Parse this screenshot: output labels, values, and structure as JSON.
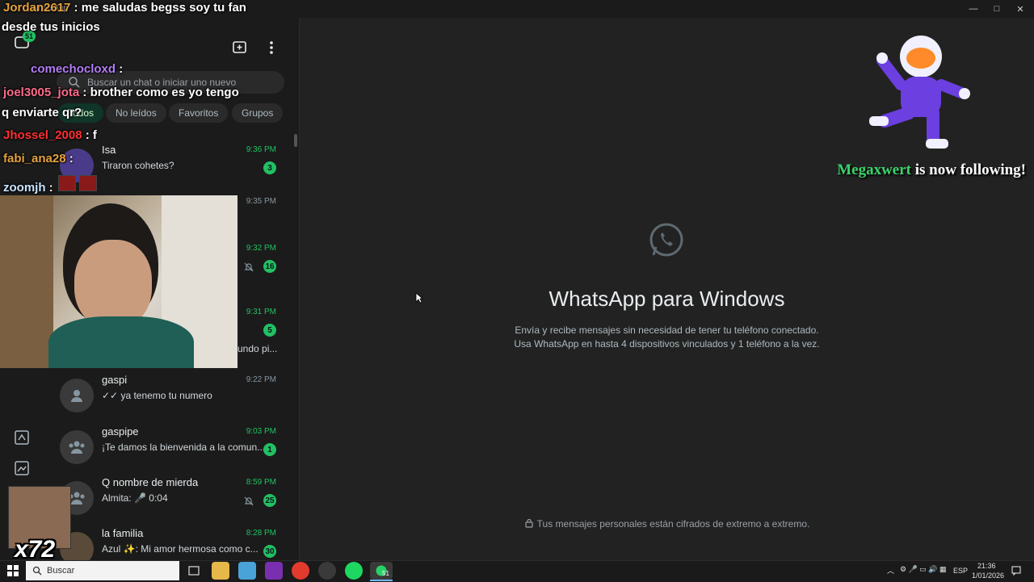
{
  "window": {
    "title": "WhatsApp",
    "min": "—",
    "max": "□",
    "close": "✕"
  },
  "nav": {
    "chats_badge": "51"
  },
  "search": {
    "placeholder": "Buscar un chat o iniciar uno nuevo"
  },
  "filters": [
    "Todos",
    "No leídos",
    "Favoritos",
    "Grupos"
  ],
  "chats": [
    {
      "name": "Isa",
      "preview": "Tiraron cohetes?",
      "time": "9:36 PM",
      "badge": "3",
      "muted": false
    },
    {
      "name": "",
      "preview": "",
      "time": "9:35 PM",
      "badge": "",
      "muted": false
    },
    {
      "name": "",
      "preview": "",
      "time": "9:32 PM",
      "badge": "16",
      "muted": true
    },
    {
      "name": "",
      "preview": "undo pi...",
      "time": "9:31 PM",
      "badge": "5",
      "muted": false
    },
    {
      "name": "gaspi",
      "preview": "✓✓ ya tenemo tu numero",
      "time": "9:22 PM",
      "badge": "",
      "muted": false
    },
    {
      "name": "gaspipe",
      "preview": "¡Te damos la bienvenida a la comun...",
      "time": "9:03 PM",
      "badge": "1",
      "muted": false
    },
    {
      "name": "Q nombre de mierda",
      "preview": "Almita: 🎤 0:04",
      "time": "8:59 PM",
      "badge": "25",
      "muted": true
    },
    {
      "name": "la familia",
      "preview": "Azul ✨: Mi amor hermosa como c...",
      "time": "8:28 PM",
      "badge": "30",
      "muted": false
    }
  ],
  "main": {
    "title": "WhatsApp para Windows",
    "desc1": "Envía y recibe mensajes sin necesidad de tener tu teléfono conectado.",
    "desc2": "Usa WhatsApp en hasta 4 dispositivos vinculados y 1 teléfono a la vez.",
    "encryption": "Tus mensajes personales están cifrados de extremo a extremo."
  },
  "stream_chat": [
    {
      "user": "Jordan2617",
      "sep": " : ",
      "msg": "me saludas begss soy tu fan"
    },
    {
      "user": "",
      "sep": "",
      "msg": "desde tus inicios"
    },
    {
      "user": "comechocloxd",
      "sep": " :",
      "msg": ""
    },
    {
      "user": "joel3005_jota",
      "sep": " : ",
      "msg": "brother como es yo tengo"
    },
    {
      "user": "",
      "sep": "",
      "msg": "q enviarte qr?"
    },
    {
      "user": "Jhossel_2008",
      "sep": " : ",
      "msg": "f"
    },
    {
      "user": "fabi_ana28",
      "sep": " :",
      "msg": ""
    },
    {
      "user": "zoomjh",
      "sep": " :",
      "msg": ""
    }
  ],
  "follow_alert": {
    "name": "Megaxwert",
    "text": " is now following!"
  },
  "overlay_counter": "x72",
  "taskbar": {
    "search_label": "Buscar",
    "lang": "ESP",
    "time": "21:36",
    "date": "1/01/2026",
    "wa_badge": "51"
  },
  "colors": {
    "accent": "#21c063",
    "background": "#222222",
    "sidebar": "#1b1b1b"
  }
}
